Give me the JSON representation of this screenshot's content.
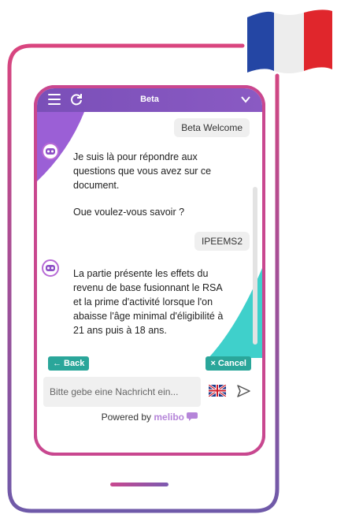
{
  "header": {
    "title": "Beta"
  },
  "messages": [
    {
      "role": "user",
      "text": "Beta Welcome"
    },
    {
      "role": "bot",
      "text": "Je suis là pour répondre aux questions que vous avez sur ce document."
    },
    {
      "role": "bot",
      "text": "Oue voulez-vous savoir ?"
    },
    {
      "role": "user",
      "text": "IPEEMS2"
    },
    {
      "role": "bot",
      "text": "La partie présente les effets du revenu de base fusionnant le RSA et la prime d'activité lorsque l'on abaisse l'âge minimal d'éligibilité à 21 ans puis à 18 ans."
    }
  ],
  "actions": {
    "back_label": "← Back",
    "cancel_label": "× Cancel"
  },
  "input": {
    "placeholder": "Bitte gebe eine Nachricht ein..."
  },
  "footer": {
    "powered_by": "Powered by",
    "brand": "melibo"
  },
  "colors": {
    "accent_purple": "#7a4fb8",
    "accent_teal": "#2aa69a",
    "frame_pink": "#d7478a"
  },
  "icons": {
    "menu": "menu-icon",
    "refresh": "refresh-icon",
    "collapse": "chevron-down-icon",
    "send": "send-icon",
    "language": "uk-flag-icon",
    "country": "france-flag-icon",
    "bot": "robot-avatar-icon"
  }
}
